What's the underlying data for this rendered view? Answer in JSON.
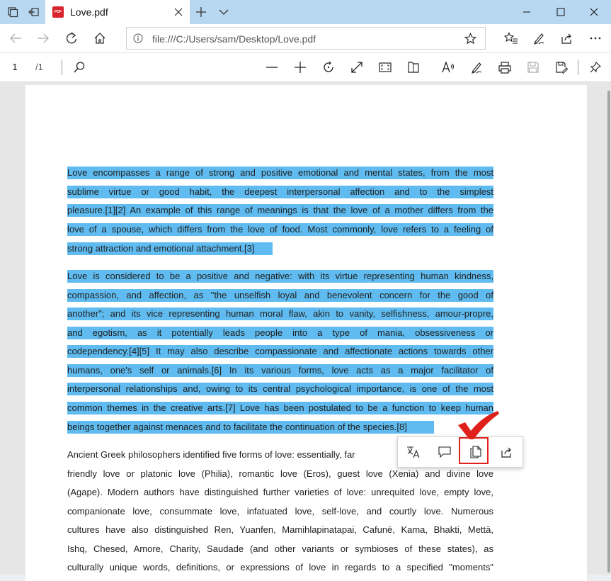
{
  "tab": {
    "title": "Love.pdf",
    "pdf_badge": "PDF"
  },
  "address": {
    "url": "file:///C:/Users/sam/Desktop/Love.pdf"
  },
  "pdf_toolbar": {
    "page_number": "1",
    "page_total": "/1"
  },
  "colors": {
    "selection": "#60bcf0",
    "highlight_box": "#e0201b",
    "titlebar": "#b8d8f2"
  },
  "document": {
    "lines": [
      "Love encompasses a range of strong and positive emotional and mental states, from the most",
      "sublime virtue or good habit, the deepest interpersonal affection and to the simplest",
      "pleasure.[1][2] An example of this range of meanings is that the love of a mother differs from the",
      "love of a spouse, which differs from the love of food. Most commonly, love refers to a feeling of",
      "strong attraction and emotional attachment.[3]",
      "Love is considered to be a positive and negative: with its virtue representing human kindness,",
      "compassion, and affection, as \"the unselfish loyal and benevolent concern for the good of",
      "another\"; and its vice representing human moral flaw, akin to vanity, selfishness, amour-propre,",
      "and egotism, as it potentially leads people into a type of mania, obsessiveness or",
      "codependency.[4][5] It may also describe compassionate and affectionate actions towards other",
      "humans, one's self or animals.[6] In its various forms, love acts as a major facilitator of",
      "interpersonal relationships and, owing to its central psychological importance, is one of the most",
      "common themes in the creative arts.[7] Love has been postulated to be a function to keep human",
      "beings together against menaces and to facilitate the continuation of the species.[8]",
      "Ancient Greek philosophers identified five forms of love: essentially, far",
      "friendly love or platonic love (Philia), romantic love (Eros), guest love (Xenia) and divine love",
      "(Agape). Modern authors have distinguished further varieties of love: unrequited love, empty love,",
      "companionate love, consummate love, infatuated love, self-love, and courtly love. Numerous",
      "cultures have also distinguished Ren, Yuanfen, Mamihlapinatapai, Cafuné, Kama, Bhakti, Mettā,",
      "Ishq, Chesed, Amore, Charity, Saudade (and other variants or symbioses of these states), as",
      "culturally unique words, definitions, or expressions of love in regards to a specified \"moments\""
    ]
  },
  "selection_popup": {
    "buttons": [
      "translate-icon",
      "comment-icon",
      "copy-icon",
      "share-icon"
    ],
    "highlighted": "copy-icon"
  }
}
